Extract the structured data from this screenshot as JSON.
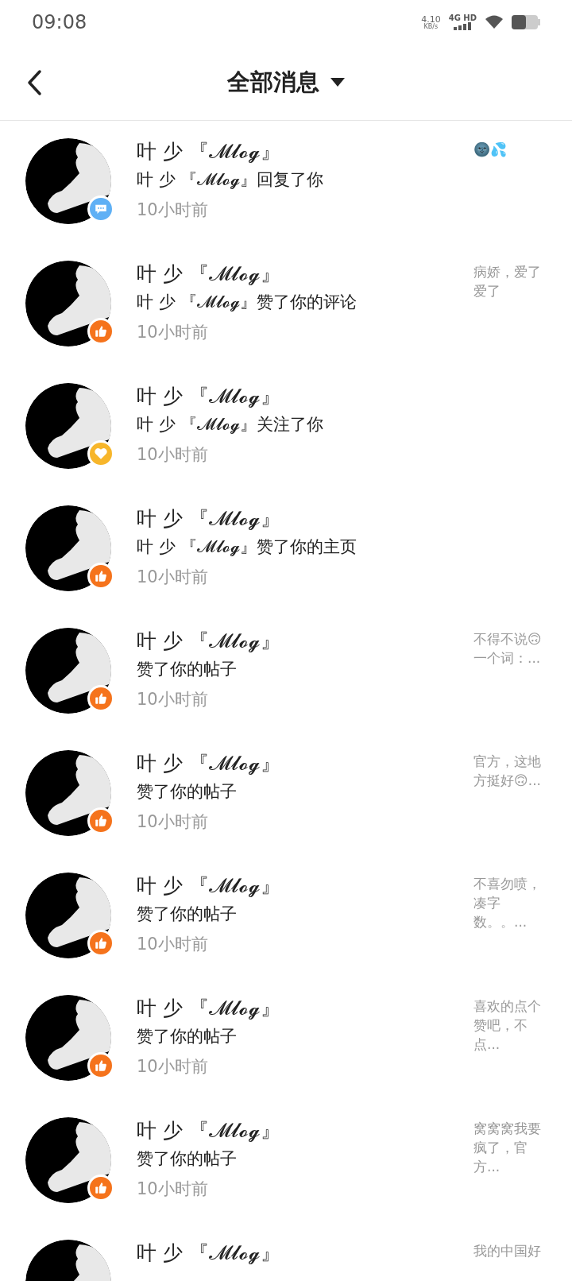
{
  "status_bar": {
    "time": "09:08",
    "speed": "4.10",
    "speed_unit": "KB/s",
    "network": "4G HD"
  },
  "header": {
    "title": "全部消息"
  },
  "messages": [
    {
      "name": "叶 少 『𝓜𝓵𝓸𝓰』",
      "action": "叶 少 『𝓜𝓵𝓸𝓰』回复了你",
      "time": "10小时前",
      "kind": "reply",
      "preview": "🌚💦"
    },
    {
      "name": "叶 少 『𝓜𝓵𝓸𝓰』",
      "action": "叶 少 『𝓜𝓵𝓸𝓰』赞了你的评论",
      "time": "10小时前",
      "kind": "like",
      "preview": "病娇，爱了爱了"
    },
    {
      "name": "叶 少 『𝓜𝓵𝓸𝓰』",
      "action": "叶 少 『𝓜𝓵𝓸𝓰』关注了你",
      "time": "10小时前",
      "kind": "follow"
    },
    {
      "name": "叶 少 『𝓜𝓵𝓸𝓰』",
      "action": "叶 少 『𝓜𝓵𝓸𝓰』赞了你的主页",
      "time": "10小时前",
      "kind": "like"
    },
    {
      "name": "叶 少 『𝓜𝓵𝓸𝓰』",
      "action": "赞了你的帖子",
      "time": "10小时前",
      "kind": "like",
      "preview": "不得不说🙃一个词：..."
    },
    {
      "name": "叶 少 『𝓜𝓵𝓸𝓰』",
      "action": "赞了你的帖子",
      "time": "10小时前",
      "kind": "like",
      "preview": "官方，这地方挺好🙃..."
    },
    {
      "name": "叶 少 『𝓜𝓵𝓸𝓰』",
      "action": "赞了你的帖子",
      "time": "10小时前",
      "kind": "like",
      "preview": "不喜勿喷，凑字数。。..."
    },
    {
      "name": "叶 少 『𝓜𝓵𝓸𝓰』",
      "action": "赞了你的帖子",
      "time": "10小时前",
      "kind": "like",
      "preview": "喜欢的点个赞吧，不点..."
    },
    {
      "name": "叶 少 『𝓜𝓵𝓸𝓰』",
      "action": "赞了你的帖子",
      "time": "10小时前",
      "kind": "like",
      "preview": "窝窝窝我要疯了，官方..."
    },
    {
      "name": "叶 少 『𝓜𝓵𝓸𝓰』",
      "preview": "我的中国好"
    }
  ]
}
